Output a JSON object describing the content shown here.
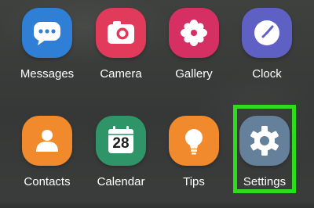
{
  "apps": [
    {
      "label": "Messages",
      "icon": "messages-icon",
      "color": "#2f7fd6"
    },
    {
      "label": "Camera",
      "icon": "camera-icon",
      "color": "#e23a5a"
    },
    {
      "label": "Gallery",
      "icon": "gallery-icon",
      "color": "#d62f64"
    },
    {
      "label": "Clock",
      "icon": "clock-icon",
      "color": "#5e60c4"
    },
    {
      "label": "Contacts",
      "icon": "contacts-icon",
      "color": "#f08a2c"
    },
    {
      "label": "Calendar",
      "icon": "calendar-icon",
      "color": "#2f9467",
      "day": "28"
    },
    {
      "label": "Tips",
      "icon": "lightbulb-icon",
      "color": "#f08a2c"
    },
    {
      "label": "Settings",
      "icon": "gear-icon",
      "color": "#64809b"
    }
  ],
  "highlight_color": "#2ddc1a"
}
